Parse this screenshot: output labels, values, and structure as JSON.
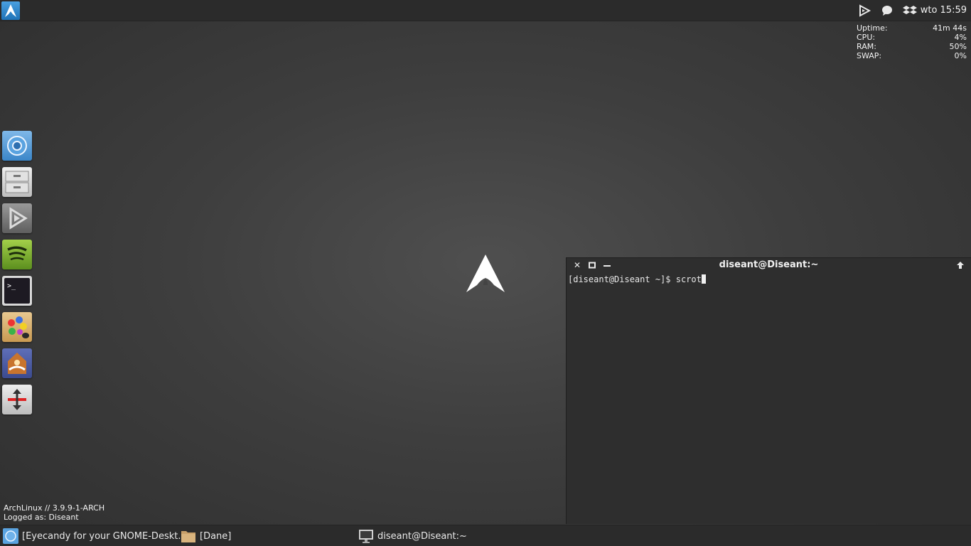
{
  "top_panel": {
    "menu_icon": "arch-logo-icon",
    "tray_icons": [
      "arch-play-icon",
      "chat-bubble-icon",
      "dropbox-icon"
    ],
    "clock": "wto 15:59"
  },
  "sysmon": [
    {
      "label": "Uptime:",
      "value": "41m 44s"
    },
    {
      "label": "CPU:",
      "value": "4%"
    },
    {
      "label": "RAM:",
      "value": "50%"
    },
    {
      "label": "SWAP:",
      "value": "0%"
    }
  ],
  "dock": {
    "items": [
      "chromium-icon",
      "file-cabinet-icon",
      "media-player-icon",
      "spotify-icon",
      "terminal-icon",
      "paint-icon",
      "system-app-icon",
      "vertical-resize-icon"
    ]
  },
  "terminal": {
    "title": "diseant@Diseant:~",
    "prompt": "[diseant@Diseant ~]$ scrot"
  },
  "sysinfo": {
    "line1": "ArchLinux // 3.9.9-1-ARCH",
    "line2": "Logged as: Diseant"
  },
  "taskbar": {
    "tasks": [
      {
        "label": "[Eyecandy for your GNOME-Deskt...",
        "icon": "chromium-icon"
      },
      {
        "label": "[Dane]",
        "icon": "folder-icon"
      },
      {
        "label": "diseant@Diseant:~",
        "icon": "monitor-icon"
      }
    ]
  },
  "colors": {
    "panel": "#2b2b2b",
    "terminal_bg": "#2e2e2e",
    "arch_blue": "#1f73b8"
  }
}
